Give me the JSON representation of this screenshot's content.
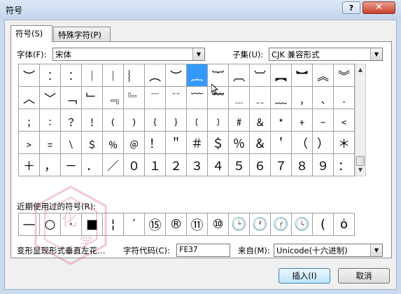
{
  "window": {
    "title": "符号",
    "help_label": "?",
    "close_label": "✕"
  },
  "tabs": [
    {
      "label": "符号(S)",
      "active": true
    },
    {
      "label": "特殊字符(P)",
      "active": false
    }
  ],
  "font": {
    "label": "字体(F):",
    "value": "宋体"
  },
  "subset": {
    "label": "子集(U):",
    "value": "CJK 兼容形式"
  },
  "grid_rows": [
    [
      "︶",
      "︰",
      "︰",
      "︱",
      "︱",
      "︴",
      "︵",
      "︶",
      "︷",
      "︸",
      "︹",
      "︺",
      "︻",
      "︼",
      "︽",
      "︾"
    ],
    [
      "︿",
      "﹀",
      "﹁",
      "﹂",
      "﹃",
      "﹄",
      "﹉",
      "﹊",
      "﹋",
      "﹌",
      "﹍",
      "﹎",
      "﹏",
      "﹐",
      "﹑",
      "﹒"
    ],
    [
      "﹔",
      "﹕",
      "﹖",
      "﹗",
      "﹙",
      "﹚",
      "﹛",
      "﹜",
      "﹝",
      "﹞",
      "﹟",
      "﹠",
      "﹡",
      "﹢",
      "﹣",
      "﹤"
    ],
    [
      "﹥",
      "﹦",
      "﹨",
      "﹩",
      "﹪",
      "﹫",
      "！",
      "＂",
      "＃",
      "＄",
      "％",
      "＆",
      "＇",
      "（",
      "）",
      "＊"
    ],
    [
      "＋",
      "，",
      "－",
      "．",
      "／",
      "０",
      "１",
      "２",
      "３",
      "４",
      "５",
      "６",
      "７",
      "８",
      "９",
      "："
    ]
  ],
  "selected_cell": {
    "row": 0,
    "col": 8
  },
  "recent": {
    "label": "近期使用过的符号(R):",
    "symbols": [
      "—",
      "○",
      "·",
      "■",
      "¦",
      "′",
      "⑮",
      "®",
      "⑪",
      "⑩",
      "🕒",
      "🕐",
      "🕜",
      "🕓",
      "(",
      "ȯ",
      "⑭"
    ]
  },
  "char_name": "变形显现形式垂直左花…",
  "char_code": {
    "label": "字符代码(C):",
    "value": "FE37"
  },
  "from": {
    "label": "来自(M):",
    "value": "Unicode(十六进制)"
  },
  "buttons": {
    "insert": "插入(I)",
    "cancel": "取消"
  },
  "watermark": {
    "text1": "化",
    "text2": "学"
  }
}
